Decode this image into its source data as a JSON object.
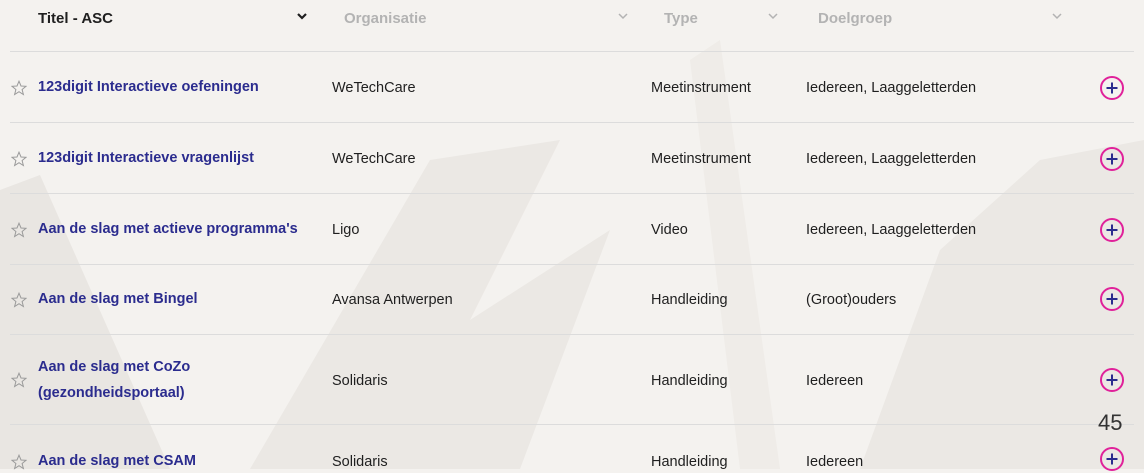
{
  "header": {
    "columns": [
      {
        "label": "Titel - ASC"
      },
      {
        "label": "Organisatie"
      },
      {
        "label": "Type"
      },
      {
        "label": "Doelgroep"
      }
    ]
  },
  "rows": [
    {
      "title": "123digit Interactieve oefeningen",
      "org": "WeTechCare",
      "type": "Meetinstrument",
      "doelgroep": "Iedereen, Laaggeletterden"
    },
    {
      "title": "123digit Interactieve vragenlijst",
      "org": "WeTechCare",
      "type": "Meetinstrument",
      "doelgroep": "Iedereen, Laaggeletterden"
    },
    {
      "title": "Aan de slag met actieve programma's",
      "org": "Ligo",
      "type": "Video",
      "doelgroep": "Iedereen, Laaggeletterden"
    },
    {
      "title": "Aan de slag met Bingel",
      "org": "Avansa Antwerpen",
      "type": "Handleiding",
      "doelgroep": "(Groot)ouders"
    },
    {
      "title_line1": "Aan de slag met CoZo",
      "title_line2": "(gezondheidsportaal)",
      "org": "Solidaris",
      "type": "Handleiding",
      "doelgroep": "Iedereen"
    },
    {
      "title": "Aan de slag met CSAM",
      "org": "Solidaris",
      "type": "Handleiding",
      "doelgroep": "Iedereen"
    }
  ],
  "page_number": "45",
  "colors": {
    "title": "#2b2c8e",
    "accent": "#e0219a",
    "divider": "#dcdcdc",
    "background": "#f4f2ef"
  },
  "icons": {
    "row_favorite": "star-outline-icon",
    "row_add": "plus-circle-icon",
    "sort": "chevron-down-icon"
  }
}
